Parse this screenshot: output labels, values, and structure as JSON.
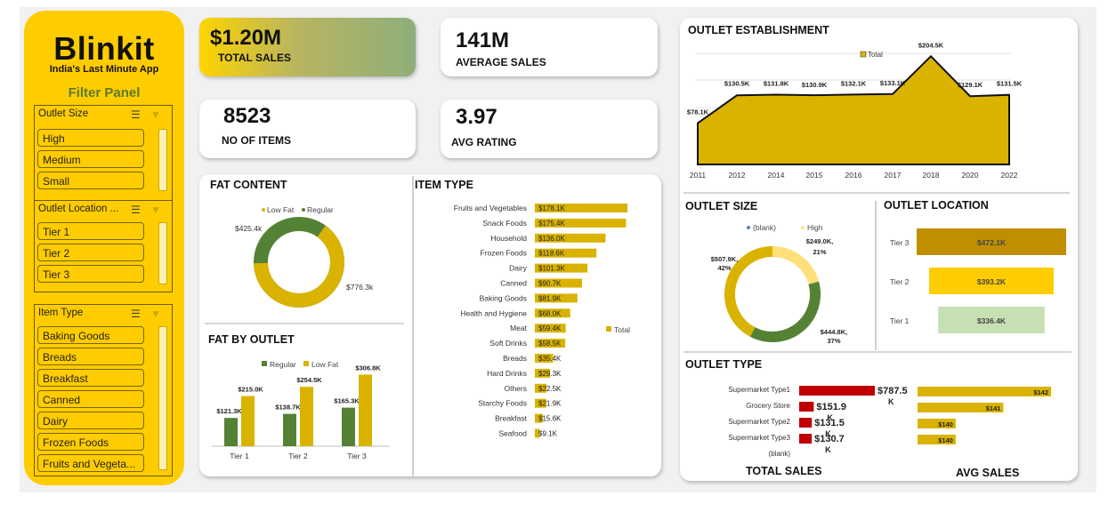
{
  "sidebar": {
    "brand": "Blinkit",
    "tagline": "India's Last Minute App",
    "filter_title": "Filter Panel",
    "slicers": [
      {
        "title": "Outlet Size",
        "items": [
          "High",
          "Medium",
          "Small"
        ]
      },
      {
        "title": "Outlet Location ...",
        "items": [
          "Tier 1",
          "Tier 2",
          "Tier 3"
        ]
      },
      {
        "title": "Item Type",
        "items": [
          "Baking Goods",
          "Breads",
          "Breakfast",
          "Canned",
          "Dairy",
          "Frozen Foods",
          "Fruits and Vegeta..."
        ]
      }
    ]
  },
  "kpis": {
    "total_sales": {
      "value": "$1.20M",
      "label": "TOTAL SALES"
    },
    "average_sales": {
      "value": "141M",
      "label": "AVERAGE SALES"
    },
    "no_of_items": {
      "value": "8523",
      "label": "NO OF ITEMS"
    },
    "avg_rating": {
      "value": "3.97",
      "label": "AVG RATING"
    }
  },
  "colors": {
    "gold": "#d9b300",
    "green": "#548235",
    "yellow_brand": "#ffcc00",
    "red": "#c00000",
    "light_yellow": "#ffe07a"
  },
  "chart_data": [
    {
      "id": "fat_content",
      "type": "pie",
      "title": "FAT CONTENT",
      "categories": [
        "Low Fat",
        "Regular"
      ],
      "values": [
        776.3,
        425.4
      ],
      "data_labels": [
        "$776.3k",
        "$425.4k"
      ],
      "legend": "top",
      "donut": true
    },
    {
      "id": "fat_by_outlet",
      "type": "bar",
      "title": "FAT BY OUTLET",
      "categories": [
        "Tier 1",
        "Tier 2",
        "Tier 3"
      ],
      "series": [
        {
          "name": "Regular",
          "values": [
            121.3,
            138.7,
            165.3
          ],
          "labels": [
            "$121.3K",
            "$138.7K",
            "$165.3K"
          ]
        },
        {
          "name": "Low Fat",
          "values": [
            215.0,
            254.5,
            306.8
          ],
          "labels": [
            "$215.0K",
            "$254.5K",
            "$306.8K"
          ]
        }
      ],
      "legend": "top"
    },
    {
      "id": "item_type",
      "type": "bar",
      "orientation": "horizontal",
      "title": "ITEM TYPE",
      "categories": [
        "Fruits and Vegetables",
        "Snack Foods",
        "Household",
        "Frozen Foods",
        "Dairy",
        "Canned",
        "Baking Goods",
        "Health and Hygiene",
        "Meat",
        "Soft Drinks",
        "Breads",
        "Hard Drinks",
        "Others",
        "Starchy Foods",
        "Breakfast",
        "Seafood"
      ],
      "values": [
        178.1,
        175.4,
        136.0,
        118.6,
        101.3,
        90.7,
        81.9,
        68.0,
        59.4,
        58.5,
        35.4,
        29.3,
        22.5,
        21.9,
        15.6,
        9.1
      ],
      "labels": [
        "$178.1K",
        "$175.4K",
        "$136.0K",
        "$118.6K",
        "$101.3K",
        "$90.7K",
        "$81.9K",
        "$68.0K",
        "$59.4K",
        "$58.5K",
        "$35.4K",
        "$29.3K",
        "$22.5K",
        "$21.9K",
        "$15.6K",
        "$9.1K"
      ],
      "legend": [
        "Total"
      ]
    },
    {
      "id": "outlet_establishment",
      "type": "area",
      "title": "OUTLET ESTABLISHMENT",
      "x": [
        "2011",
        "2012",
        "2014",
        "2015",
        "2016",
        "2017",
        "2018",
        "2020",
        "2022"
      ],
      "values": [
        78.1,
        130.5,
        131.8,
        130.9,
        132.1,
        133.1,
        204.5,
        129.1,
        131.5
      ],
      "labels": [
        "$78.1K",
        "$130.5K",
        "$131.8K",
        "$130.9K",
        "$132.1K",
        "$133.1K",
        "$204.5K",
        "$129.1K",
        "$131.5K"
      ],
      "legend": [
        "Total"
      ]
    },
    {
      "id": "outlet_size",
      "type": "pie",
      "title": "OUTLET SIZE",
      "categories": [
        "(blank)",
        "High"
      ],
      "values": [
        507.9,
        249.0,
        444.8
      ],
      "data_labels": [
        "$507.9K,",
        "42%",
        "$249.0K,",
        "21%",
        "$444.8K,",
        "37%"
      ],
      "legend": "top",
      "donut": true
    },
    {
      "id": "outlet_location",
      "type": "bar",
      "orientation": "horizontal",
      "title": "OUTLET LOCATION",
      "categories": [
        "Tier 3",
        "Tier 2",
        "Tier 1"
      ],
      "values": [
        472.1,
        393.2,
        336.4
      ],
      "labels": [
        "$472.1K",
        "$393.2K",
        "$336.4K"
      ]
    },
    {
      "id": "outlet_type",
      "type": "bar",
      "orientation": "horizontal",
      "title": "OUTLET TYPE",
      "categories": [
        "Supermarket Type1",
        "Grocery Store",
        "Supermarket Type2",
        "Supermarket Type3",
        "(blank)"
      ],
      "series": [
        {
          "name": "TOTAL SALES",
          "values": [
            787.5,
            151.9,
            131.5,
            130.7
          ],
          "labels": [
            "$787.5 K",
            "$151.9 K",
            "$131.5 K",
            "$130.7 K"
          ]
        },
        {
          "name": "AVG SALES",
          "values": [
            142,
            141,
            140,
            140
          ],
          "labels": [
            "$142",
            "$141",
            "$140",
            "$140"
          ]
        }
      ]
    }
  ]
}
